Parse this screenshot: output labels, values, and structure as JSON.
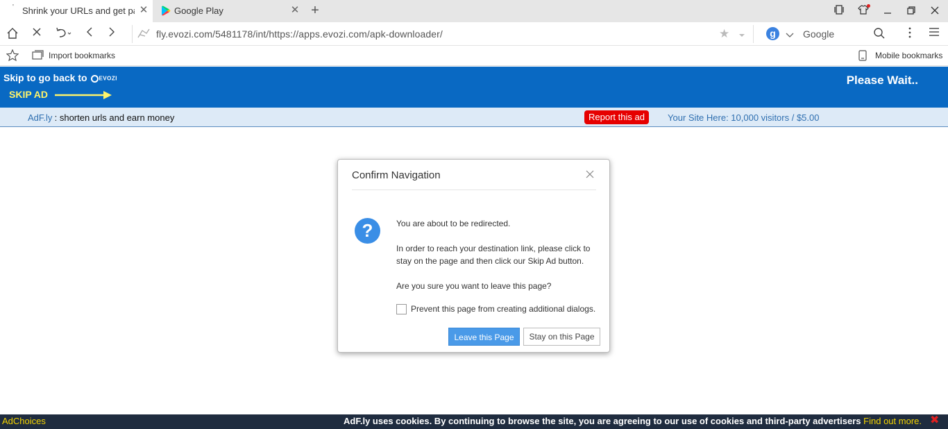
{
  "tabs": [
    {
      "title": "Shrink your URLs and get paid!",
      "active": true
    },
    {
      "title": "Google Play",
      "active": false
    }
  ],
  "address": {
    "url": "fly.evozi.com/5481178/int/https://apps.evozi.com/apk-downloader/",
    "search_engine": "Google"
  },
  "bookmarks": {
    "import_label": "Import bookmarks",
    "mobile_label": "Mobile bookmarks"
  },
  "banner": {
    "skip_back": "Skip to go back to",
    "evozi_logo_text": "EVOZI",
    "skip_ad": "SKIP AD",
    "please_wait": "Please Wait..",
    "bg_color": "#0969c3"
  },
  "subbar": {
    "adfly_link": "AdF.ly",
    "tagline": " : shorten urls and earn money",
    "report_ad": "Report this ad",
    "your_site": "Your Site Here: 10,000 visitors / $5.00"
  },
  "dialog": {
    "title": "Confirm Navigation",
    "line1": "You are about to be redirected.",
    "line2": "In order to reach your destination link, please click to stay on the page and then click our Skip Ad button.",
    "line3": "Are you sure you want to leave this page?",
    "checkbox_label": "Prevent this page from creating additional dialogs.",
    "leave_button": "Leave this Page",
    "stay_button": "Stay on this Page"
  },
  "footer": {
    "adchoices": "AdChoices",
    "cookie_text": "AdF.ly uses cookies. By continuing to browse the site, you are agreeing to our use of cookies and third-party advertisers",
    "find_out": "Find out more."
  }
}
